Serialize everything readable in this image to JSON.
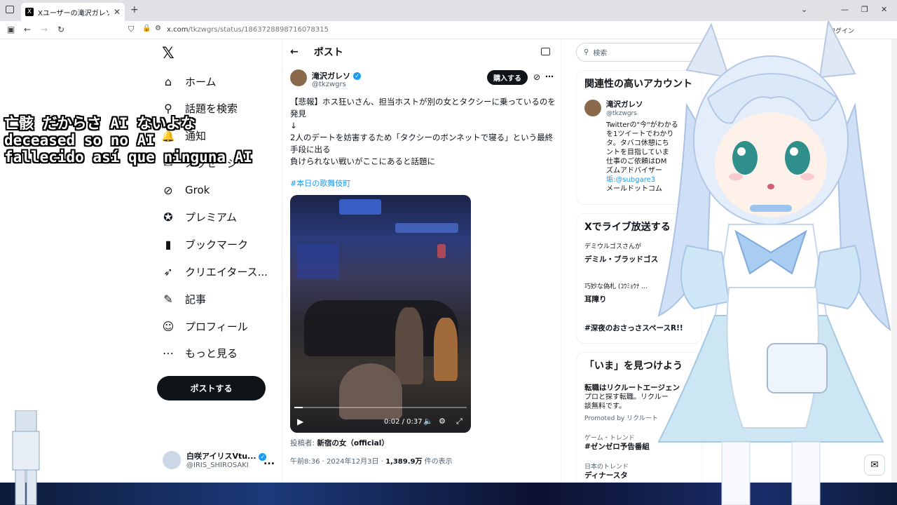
{
  "browser": {
    "tab_title": "Xユーザーの滝沢ガレソさん:「【悲報】",
    "tab_favicon": "X",
    "new_tab": "+",
    "url_host": "x.com",
    "url_path": "/tkzwgrs/status/1863728898716078315",
    "login_label": "ログイン",
    "icons": [
      "back-icon",
      "forward-icon",
      "reload-icon",
      "shield-icon",
      "lock-icon"
    ]
  },
  "nav": {
    "logo": "𝕏",
    "items": [
      {
        "label": "ホーム",
        "icon": "⌂"
      },
      {
        "label": "話題を検索",
        "icon": "⚲"
      },
      {
        "label": "通知",
        "icon": "🔔"
      },
      {
        "label": "メッセージ",
        "icon": "✉"
      },
      {
        "label": "Grok",
        "icon": "⊘"
      },
      {
        "label": "プレミアム",
        "icon": "✪"
      },
      {
        "label": "ブックマーク",
        "icon": "▮"
      },
      {
        "label": "クリエイタース...",
        "icon": "➶"
      },
      {
        "label": "記事",
        "icon": "✎"
      },
      {
        "label": "プロフィール",
        "icon": "☺"
      },
      {
        "label": "もっと見る",
        "icon": "⋯"
      }
    ],
    "post_button": "ポストする",
    "account_name": "白咲アイリスVtu...",
    "account_handle": "@IRIS_SHIROSAKI",
    "account_more": "..."
  },
  "subtitles": {
    "line1": "亡骸 だからさ AI ないよな",
    "line2": "deceased so no AI",
    "line3": "fallecido así que ninguna AI"
  },
  "post": {
    "header_title": "ポスト",
    "back": "←",
    "author_name": "滝沢ガレソ",
    "author_handle": "@tkzwgrs",
    "buy_button": "購入する",
    "text_lines": [
      "【悲報】ホス狂いさん、担当ホストが別の女とタクシーに乗っているのを",
      "発見",
      "↓",
      "2人のデートを妨害するため「タクシーのボンネットで寝る」という最終",
      "手段に出る",
      "負けられない戦いがここにあると話題に"
    ],
    "hashtag": "#本日の歌舞伎町",
    "video": {
      "time": "0:02 / 0:37",
      "progress": 0.05
    },
    "poster_label": "投稿者:",
    "poster_name": "新宿の女（official）",
    "meta_time": "午前8:36 · 2024年12月3日 · ",
    "meta_views": "1,389.9万",
    "meta_views_suffix": " 件の表示"
  },
  "sidebar": {
    "search_placeholder": "検索",
    "related_title": "関連性の高いアカウント",
    "related_name": "滝沢ガレソ",
    "related_handle": "@tkzwgrs",
    "related_bio": [
      "Twitterの\"今\"がわかる",
      "を1ツイートでわかり",
      "タ。タバコ休憩にち",
      "ントを目指していま",
      "仕事のご依頼はDM",
      "ズムアドバイザー",
      "垢:@subgare3 ",
      "メールドットコム"
    ],
    "live_title": "Xでライブ放送する",
    "live_items": [
      {
        "host": "デミウルゴスさんが",
        "title": "デミル・ブラッドゴス"
      },
      {
        "host": "巧妙な偽札 (ｺｳﾐｮｳﾅ ...",
        "title": "耳障り"
      },
      {
        "host": "",
        "title": "#深夜のおさっさスペースR!!"
      }
    ],
    "now_title": "「いま」を見つけよう",
    "ad_title": "転職はリクルートエージェン",
    "ad_body1": "プロと探す転職。リクルー",
    "ad_body2": "談無料です。",
    "ad_promo": "Promoted by リクルート",
    "trend1_cat": "ゲーム・トレンド",
    "trend1": "#ゼンゼロ予告番組",
    "trend2_cat": "日本のトレンド",
    "trend2": "ディナースタ"
  },
  "colors": {
    "accent": "#1d9bf0",
    "text": "#0f1419",
    "secondary": "#536471",
    "button_dark": "#0f1419"
  }
}
